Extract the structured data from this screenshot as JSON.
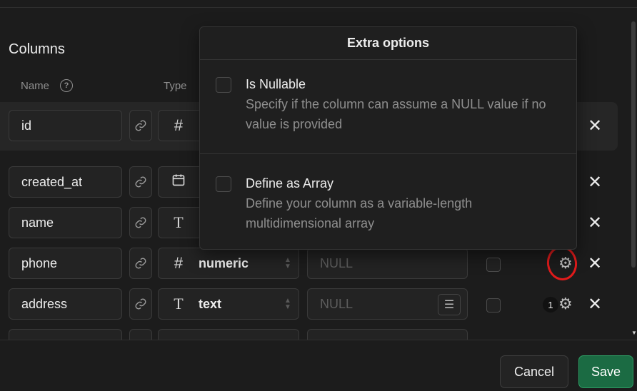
{
  "section_title": "Columns",
  "headers": {
    "name": "Name",
    "type": "Type"
  },
  "rows": [
    {
      "name": "id",
      "type_icon": "#",
      "type": "",
      "default": ""
    },
    {
      "name": "created_at",
      "type_icon": "calendar",
      "type": "",
      "default": ""
    },
    {
      "name": "name",
      "type_icon": "T",
      "type": "",
      "default": ""
    },
    {
      "name": "phone",
      "type_icon": "#",
      "type": "numeric",
      "default": "NULL"
    },
    {
      "name": "address",
      "type_icon": "T",
      "type": "text",
      "default": "NULL",
      "badge": "1"
    }
  ],
  "popover": {
    "title": "Extra options",
    "options": [
      {
        "title": "Is Nullable",
        "desc": "Specify if the column can assume a NULL value if no value is provided"
      },
      {
        "title": "Define as Array",
        "desc": "Define your column as a variable-length multidimensional array"
      }
    ]
  },
  "footer": {
    "cancel": "Cancel",
    "save": "Save"
  },
  "colors": {
    "accent": "#1b6b43",
    "highlight": "#e01b1b",
    "bg": "#1c1c1c"
  },
  "icons": [
    "help-icon",
    "link-icon",
    "hash-icon",
    "calendar-icon",
    "text-type-icon",
    "sort-icon",
    "list-icon",
    "gear-icon",
    "close-icon"
  ]
}
